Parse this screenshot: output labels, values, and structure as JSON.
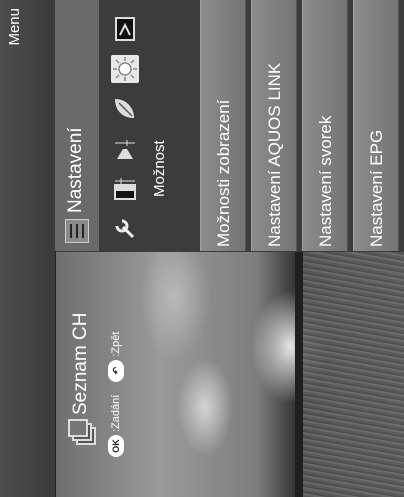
{
  "header": {
    "title": "Menu"
  },
  "channel_tab": {
    "label": "Seznam CH"
  },
  "hints": [
    {
      "button": "OK",
      "label": ":Zadání"
    },
    {
      "button": "↶",
      "label": ":Zpět"
    }
  ],
  "settings_tab": {
    "label": "Nastavení"
  },
  "category": {
    "label": "Možnost"
  },
  "icon_tabs": [
    "wrench-icon",
    "contrast-icon",
    "audio-icon",
    "leaf-icon",
    "sun-icon",
    "play-icon"
  ],
  "menu_items": [
    {
      "label": "Možnosti zobrazení"
    },
    {
      "label": "Nastavení AQUOS LINK"
    },
    {
      "label": "Nastavení svorek"
    },
    {
      "label": "Nastavení EPG"
    }
  ]
}
